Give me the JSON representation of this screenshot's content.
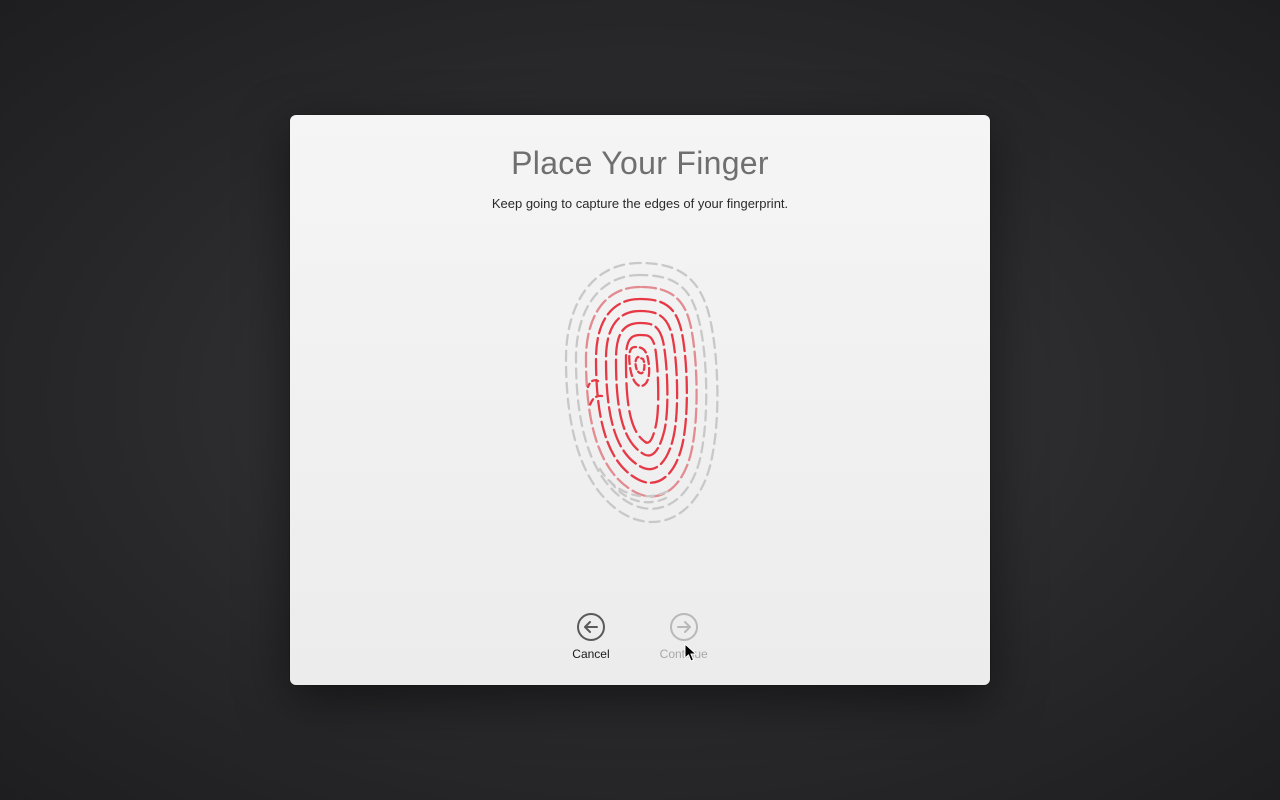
{
  "dialog": {
    "title": "Place Your Finger",
    "subtitle": "Keep going to capture the edges of your fingerprint.",
    "buttons": {
      "cancel": "Cancel",
      "continue": "Continue"
    },
    "continue_enabled": false,
    "accent_color": "#e63946",
    "inactive_color": "#c8c8c8"
  }
}
